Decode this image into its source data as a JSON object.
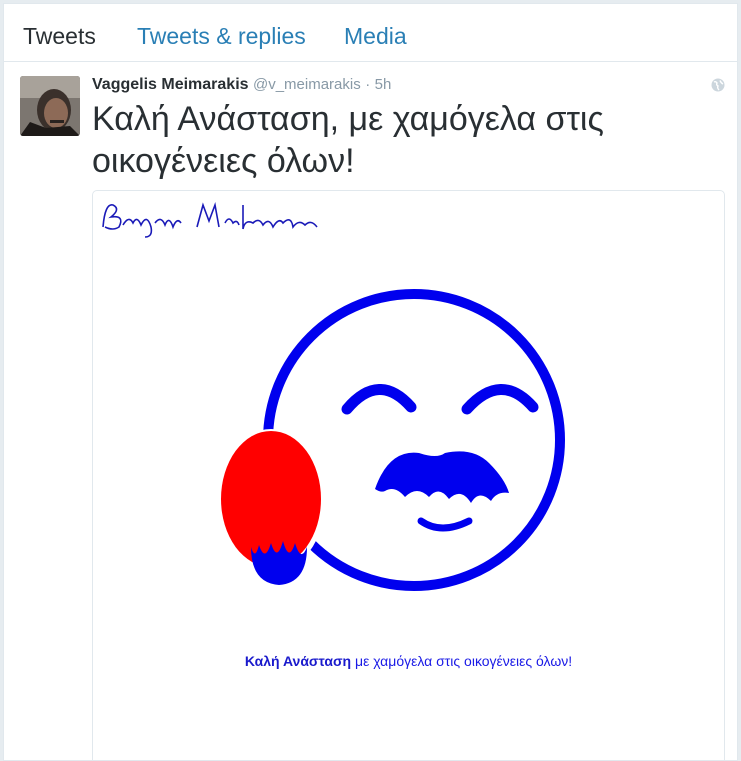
{
  "tabs": {
    "tweets": "Tweets",
    "tweets_replies": "Tweets & replies",
    "media": "Media"
  },
  "tweet": {
    "name": "Vaggelis Meimarakis",
    "handle": "@v_meimarakis",
    "separator": "·",
    "time": "5h",
    "text": "Καλή Ανάσταση, με χαμόγελα στις οικογένειες όλων!"
  },
  "image": {
    "caption_bold": "Καλή Ανάσταση",
    "caption_rest": " με χαμόγελα στις οικογένειες όλων!",
    "signature": "Βαγγέλης Μειμαράκης",
    "colors": {
      "blue": "#0000ee",
      "red": "#ff0000"
    }
  },
  "icons": {
    "globe": "globe-icon"
  }
}
